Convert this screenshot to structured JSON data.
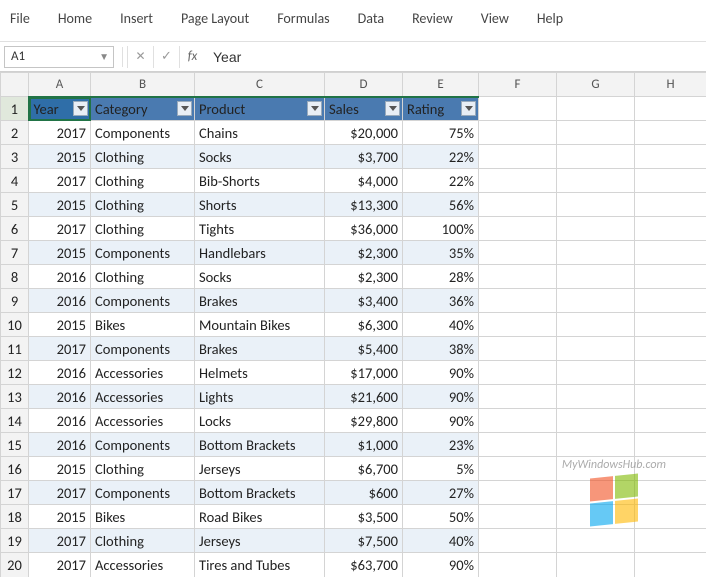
{
  "ribbon": {
    "tabs": [
      "File",
      "Home",
      "Insert",
      "Page Layout",
      "Formulas",
      "Data",
      "Review",
      "View",
      "Help"
    ]
  },
  "namebox": {
    "value": "A1"
  },
  "formula_bar": {
    "value": "Year"
  },
  "column_letters": [
    "A",
    "B",
    "C",
    "D",
    "E",
    "F",
    "G",
    "H"
  ],
  "table_headers": [
    "Year",
    "Category",
    "Product",
    "Sales",
    "Rating"
  ],
  "rows": [
    {
      "n": 2,
      "year": "2017",
      "category": "Components",
      "product": "Chains",
      "sales": "$ 20,000",
      "rating": "75%"
    },
    {
      "n": 3,
      "year": "2015",
      "category": "Clothing",
      "product": "Socks",
      "sales": "$  3,700",
      "rating": "22%"
    },
    {
      "n": 4,
      "year": "2017",
      "category": "Clothing",
      "product": "Bib-Shorts",
      "sales": "$  4,000",
      "rating": "22%"
    },
    {
      "n": 5,
      "year": "2015",
      "category": "Clothing",
      "product": "Shorts",
      "sales": "$ 13,300",
      "rating": "56%"
    },
    {
      "n": 6,
      "year": "2017",
      "category": "Clothing",
      "product": "Tights",
      "sales": "$ 36,000",
      "rating": "100%"
    },
    {
      "n": 7,
      "year": "2015",
      "category": "Components",
      "product": "Handlebars",
      "sales": "$  2,300",
      "rating": "35%"
    },
    {
      "n": 8,
      "year": "2016",
      "category": "Clothing",
      "product": "Socks",
      "sales": "$  2,300",
      "rating": "28%"
    },
    {
      "n": 9,
      "year": "2016",
      "category": "Components",
      "product": "Brakes",
      "sales": "$  3,400",
      "rating": "36%"
    },
    {
      "n": 10,
      "year": "2015",
      "category": "Bikes",
      "product": "Mountain Bikes",
      "sales": "$  6,300",
      "rating": "40%"
    },
    {
      "n": 11,
      "year": "2017",
      "category": "Components",
      "product": "Brakes",
      "sales": "$  5,400",
      "rating": "38%"
    },
    {
      "n": 12,
      "year": "2016",
      "category": "Accessories",
      "product": "Helmets",
      "sales": "$ 17,000",
      "rating": "90%"
    },
    {
      "n": 13,
      "year": "2016",
      "category": "Accessories",
      "product": "Lights",
      "sales": "$ 21,600",
      "rating": "90%"
    },
    {
      "n": 14,
      "year": "2016",
      "category": "Accessories",
      "product": "Locks",
      "sales": "$ 29,800",
      "rating": "90%"
    },
    {
      "n": 15,
      "year": "2016",
      "category": "Components",
      "product": "Bottom Brackets",
      "sales": "$  1,000",
      "rating": "23%"
    },
    {
      "n": 16,
      "year": "2015",
      "category": "Clothing",
      "product": "Jerseys",
      "sales": "$  6,700",
      "rating": "5%"
    },
    {
      "n": 17,
      "year": "2017",
      "category": "Components",
      "product": "Bottom Brackets",
      "sales": "$    600",
      "rating": "27%"
    },
    {
      "n": 18,
      "year": "2015",
      "category": "Bikes",
      "product": "Road Bikes",
      "sales": "$  3,500",
      "rating": "50%"
    },
    {
      "n": 19,
      "year": "2017",
      "category": "Clothing",
      "product": "Jerseys",
      "sales": "$  7,500",
      "rating": "40%"
    },
    {
      "n": 20,
      "year": "2017",
      "category": "Accessories",
      "product": "Tires and Tubes",
      "sales": "$ 63,700",
      "rating": "90%"
    }
  ],
  "watermark": {
    "text": "MyWindowsHub.com"
  }
}
